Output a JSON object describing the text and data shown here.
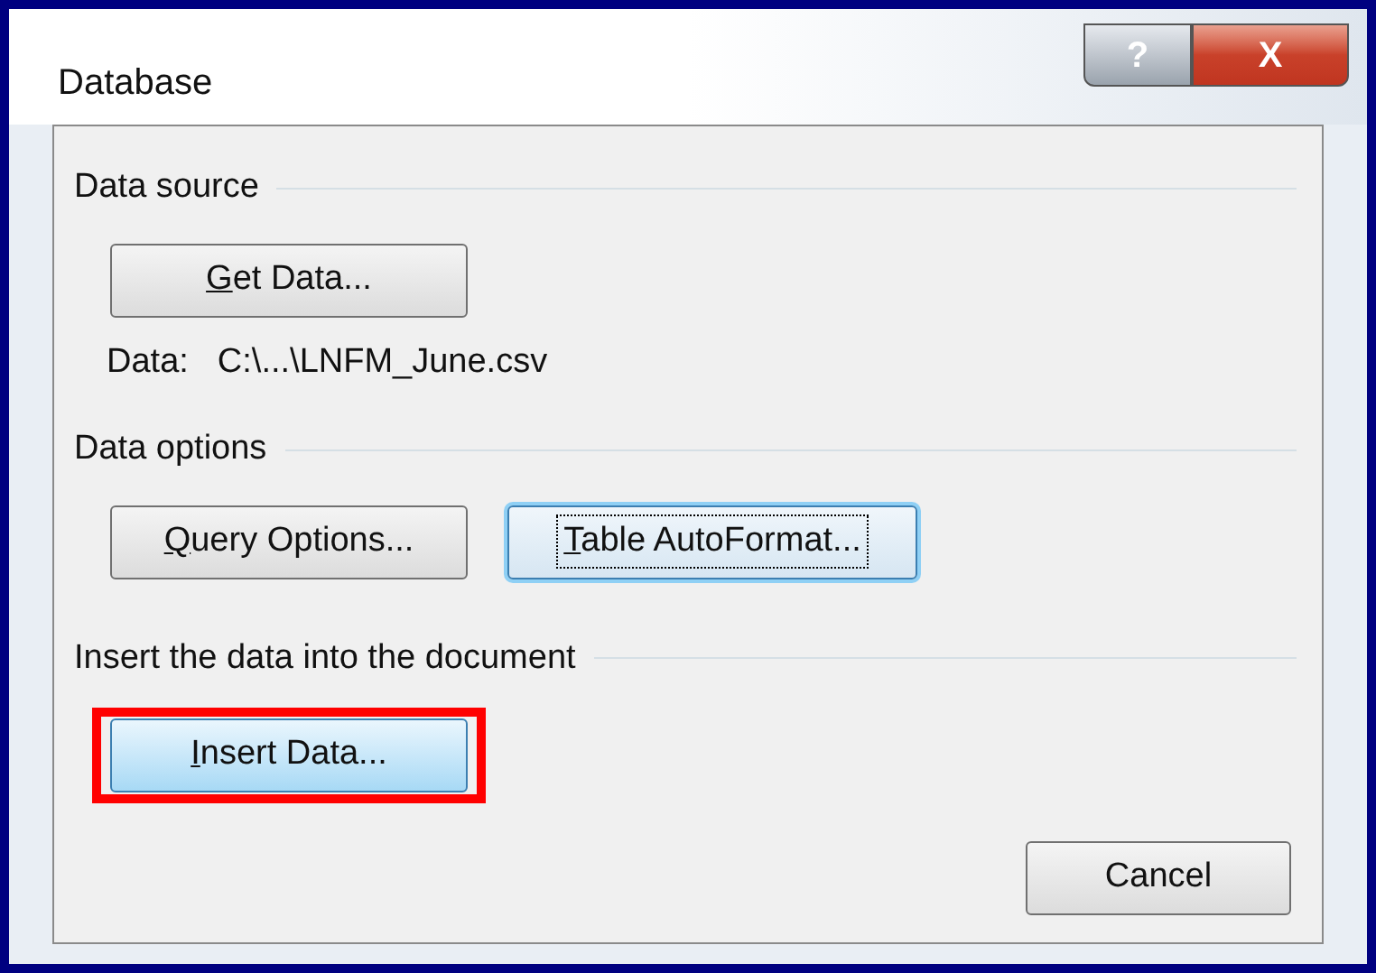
{
  "window": {
    "title": "Database",
    "title_buttons": [
      {
        "kind": "help",
        "label": "?"
      },
      {
        "kind": "close",
        "label": "X"
      }
    ]
  },
  "sections": [
    {
      "title": "Data source",
      "buttons": [
        {
          "label": "Get Data...",
          "mnemonic_underlined": true,
          "focused": false,
          "hot": false,
          "highlighted": false
        }
      ],
      "info": {
        "label": "Data:",
        "value": "C:\\...\\LNFM_June.csv"
      }
    },
    {
      "title": "Data options",
      "buttons": [
        {
          "label": "Query Options...",
          "mnemonic_underlined": true,
          "focused": false,
          "hot": false,
          "highlighted": false
        },
        {
          "label": "Table AutoFormat...",
          "mnemonic_underlined": true,
          "focused": true,
          "hot": false,
          "highlighted": false
        }
      ]
    },
    {
      "title": "Insert the data into the document",
      "buttons": [
        {
          "label": "Insert Data...",
          "mnemonic_underlined": true,
          "focused": false,
          "hot": true,
          "highlighted": true
        }
      ]
    }
  ],
  "footer_buttons": [
    {
      "label": "Cancel",
      "mnemonic_underlined": false,
      "focused": false,
      "hot": false,
      "highlighted": false
    }
  ]
}
